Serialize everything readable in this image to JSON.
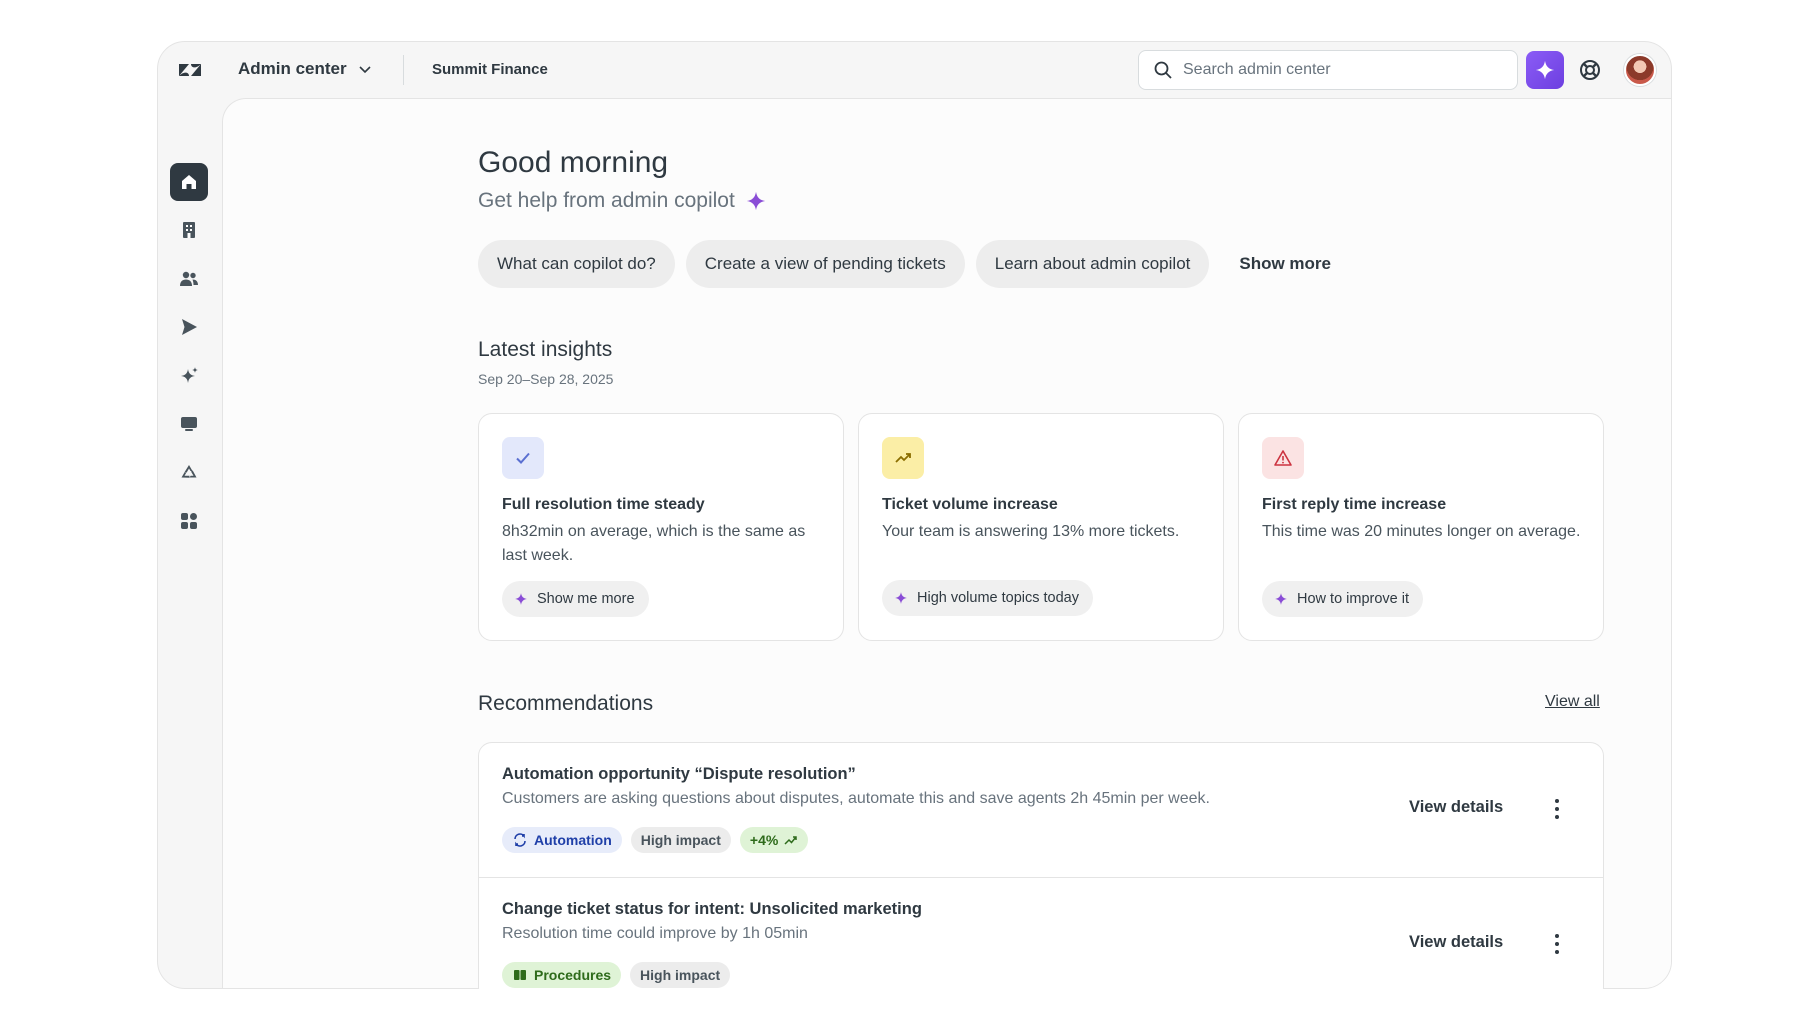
{
  "header": {
    "app_title": "Admin center",
    "org_name": "Summit Finance",
    "search_placeholder": "Search admin center"
  },
  "sidebar": {
    "items": [
      {
        "icon": "home-icon",
        "active": true
      },
      {
        "icon": "building-icon"
      },
      {
        "icon": "people-icon"
      },
      {
        "icon": "send-icon"
      },
      {
        "icon": "sparkle-icon"
      },
      {
        "icon": "chat-icon"
      },
      {
        "icon": "recycle-icon"
      },
      {
        "icon": "apps-icon"
      }
    ]
  },
  "main": {
    "greeting": "Good morning",
    "sub_greeting": "Get help from admin copilot",
    "chips": [
      "What can copilot do?",
      "Create a view of pending tickets",
      "Learn about admin copilot"
    ],
    "show_more": "Show more"
  },
  "insights": {
    "title": "Latest insights",
    "date_range": "Sep 20–Sep 28, 2025",
    "cards": [
      {
        "icon": "check-icon",
        "title": "Full resolution time steady",
        "text": "8h32min on average, which is the same as last week.",
        "action": "Show me more"
      },
      {
        "icon": "trend-up-icon",
        "title": "Ticket volume increase",
        "text": "Your team is answering 13% more tickets.",
        "action": "High volume topics today"
      },
      {
        "icon": "warning-icon",
        "title": "First reply time increase",
        "text": "This time was 20 minutes longer on average.",
        "action": "How to improve it"
      }
    ]
  },
  "recommendations": {
    "title": "Recommendations",
    "view_all": "View all",
    "items": [
      {
        "title": "Automation opportunity “Dispute resolution”",
        "desc": "Customers are asking questions about disputes, automate this and save agents 2h 45min per week.",
        "tags": [
          "Automation",
          "High impact",
          "+4%"
        ],
        "action": "View details"
      },
      {
        "title": "Change ticket status for intent: Unsolicited marketing",
        "desc": "Resolution time could improve by 1h 05min",
        "tags": [
          "Procedures",
          "High impact"
        ],
        "action": "View details"
      }
    ]
  },
  "colors": {
    "accent": "#7c4ddb",
    "text": "#2f3941",
    "muted": "#68737d"
  }
}
